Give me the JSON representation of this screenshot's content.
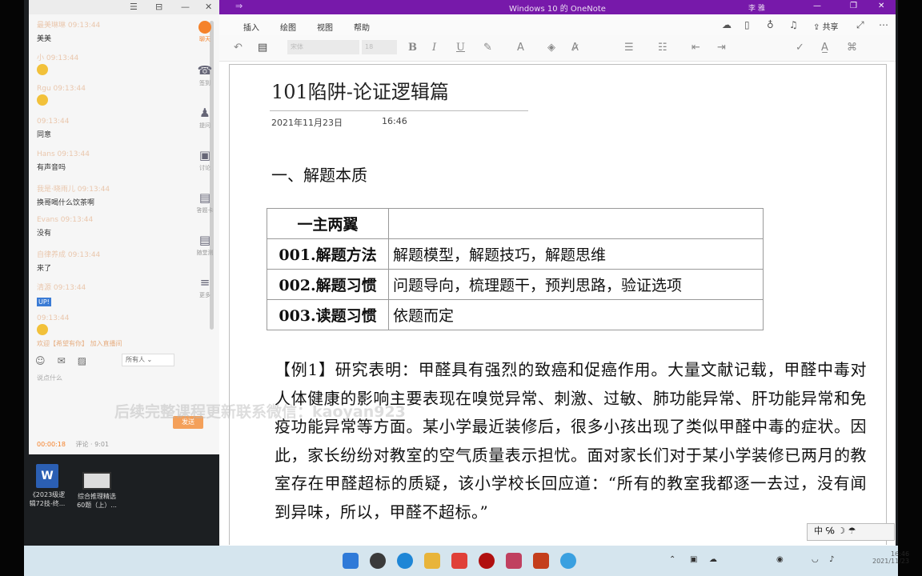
{
  "chat": {
    "controls": [
      "☰",
      "⊟",
      "—",
      "✕"
    ],
    "messages": [
      {
        "name": "最美琳琳  09:13:44",
        "text": "美美",
        "emoji": false,
        "badge": ""
      },
      {
        "name": "小 09:13:44",
        "text": "",
        "emoji": true,
        "badge": ""
      },
      {
        "name": "Rgu  09:13:44",
        "text": "",
        "emoji": true,
        "badge": ""
      },
      {
        "name": "09:13:44",
        "text": "同意",
        "emoji": false,
        "badge": ""
      },
      {
        "name": "Hans  09:13:44",
        "text": "有声音吗",
        "emoji": false,
        "badge": ""
      },
      {
        "name": "我是·晓雨儿  09:13:44",
        "text": "换哥喝什么饮茶啊",
        "emoji": false,
        "badge": ""
      },
      {
        "name": "Evans  09:13:44",
        "text": "没有",
        "emoji": false,
        "badge": ""
      },
      {
        "name": "自律养成  09:13:44",
        "text": "来了",
        "emoji": false,
        "badge": ""
      },
      {
        "name": "清源  09:13:44",
        "text": "",
        "emoji": false,
        "badge": "UP!"
      },
      {
        "name": "09:13:44",
        "text": "",
        "emoji": true,
        "badge": ""
      }
    ],
    "rail": [
      {
        "label": "聊天",
        "icon": "chat-icon",
        "glyph": ""
      },
      {
        "label": "签到",
        "icon": "phone-icon",
        "glyph": "☎"
      },
      {
        "label": "提问",
        "icon": "person-icon",
        "glyph": "♟"
      },
      {
        "label": "讨论",
        "icon": "tv-icon",
        "glyph": "▣"
      },
      {
        "label": "答题卡",
        "icon": "card-icon",
        "glyph": "▤"
      },
      {
        "label": "随堂测",
        "icon": "quiz-icon",
        "glyph": "▤"
      },
      {
        "label": "更多",
        "icon": "more-icon",
        "glyph": "≡"
      }
    ],
    "notice": "欢迎【希望有你】 加入直播间",
    "select_value": "所有人",
    "input_placeholder": "说点什么",
    "send_label": "发送",
    "live_time": "00:00:18",
    "live_info": "评论 · 9:01"
  },
  "desktop_icons": [
    {
      "caption_1": "《2023级逻",
      "caption_2": "辑72技-终..."
    },
    {
      "caption_1": "综合推理精选",
      "caption_2": "60题（上）..."
    }
  ],
  "onenote": {
    "window_title": "Windows 10 的 OneNote",
    "user": "李 雅",
    "window_buttons": [
      "—",
      "❐",
      "✕"
    ],
    "menu": [
      "插入",
      "绘图",
      "视图",
      "帮助"
    ],
    "share_label": "共享",
    "font_name": "宋体",
    "font_size": "18",
    "page": {
      "title": "101陷阱-论证逻辑篇",
      "date": "2021年11月23日",
      "time": "16:46",
      "section_heading": "一、解题本质",
      "table": [
        {
          "key": "一主两翼",
          "value": ""
        },
        {
          "key": "001.解题方法",
          "value": "解题模型，解题技巧，解题思维"
        },
        {
          "key": "002.解题习惯",
          "value": "问题导向，梳理题干，预判思路，验证选项"
        },
        {
          "key": "003.读题习惯",
          "value": "依题而定"
        }
      ],
      "example": "【例1】研究表明：甲醛具有强烈的致癌和促癌作用。大量文献记载，甲醛中毒对人体健康的影响主要表现在嗅觉异常、刺激、过敏、肺功能异常、肝功能异常和免疫功能异常等方面。某小学最近装修后，很多小孩出现了类似甲醛中毒的症状。因此，家长纷纷对教室的空气质量表示担忧。面对家长们对于某小学装修已两月的教室存在甲醛超标的质疑，该小学校长回应道：“所有的教室我都逐一去过，没有闻到异味，所以，甲醛不超标。”"
    }
  },
  "ime": "中 ℅ ☽ ☂",
  "watermark": "后续完整课程更新联系微信：kaoyan923",
  "clock": {
    "time": "16:46",
    "date": "2021/11/23"
  }
}
